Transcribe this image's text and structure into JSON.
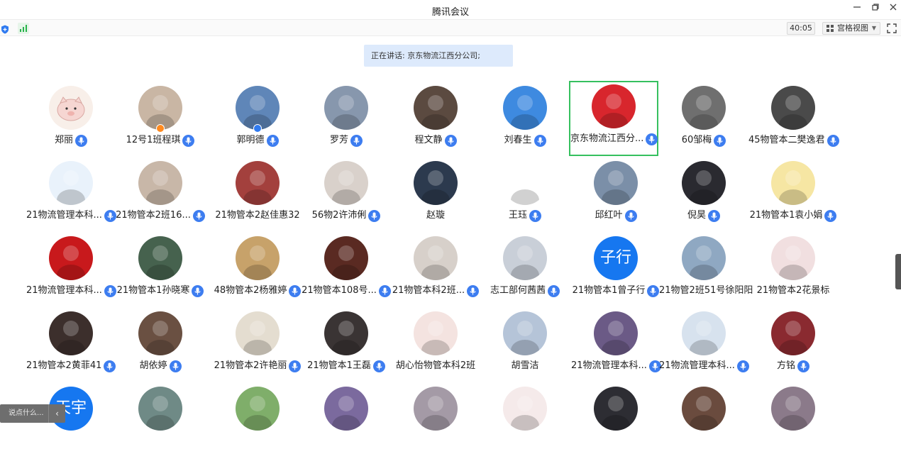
{
  "app": {
    "title": "腾讯会议"
  },
  "toolbar": {
    "timer": "40:05",
    "view_label": "宫格视图"
  },
  "speaking_banner": "正在讲话: 京东物流江西分公司;",
  "chat": {
    "placeholder": "说点什么..."
  },
  "participants": [
    {
      "name": "郑丽",
      "mic": true,
      "avatar": "pig",
      "color": "#f8efe9"
    },
    {
      "name": "12号1班程琪",
      "mic": true,
      "avatar": "photo",
      "color": "#c9b6a4",
      "badge": "host"
    },
    {
      "name": "郭明德",
      "mic": true,
      "avatar": "photo",
      "color": "#5f86b8",
      "badge": "cohost"
    },
    {
      "name": "罗芳",
      "mic": true,
      "avatar": "photo",
      "color": "#8797ad"
    },
    {
      "name": "程文静",
      "mic": true,
      "avatar": "photo",
      "color": "#5b4a40"
    },
    {
      "name": "刘春生",
      "mic": true,
      "avatar": "photo",
      "color": "#3e8ae0"
    },
    {
      "name": "京东物流江西分...",
      "mic": true,
      "avatar": "photo",
      "color": "#d8262d",
      "active": true
    },
    {
      "name": "60邹梅",
      "mic": true,
      "avatar": "photo",
      "color": "#6f6f6f"
    },
    {
      "name": "45物管本二樊逸君",
      "mic": true,
      "avatar": "photo",
      "color": "#4a4a4a"
    },
    {
      "name": "21物流管理本科...",
      "mic": true,
      "avatar": "photo",
      "color": "#e9f2fb"
    },
    {
      "name": "21物管本2班16...",
      "mic": true,
      "avatar": "photo",
      "color": "#c8b7a8"
    },
    {
      "name": "21物管本2赵佳惠32",
      "mic": false,
      "avatar": "photo",
      "color": "#a3403d"
    },
    {
      "name": "56物2许沛俐",
      "mic": true,
      "avatar": "photo",
      "color": "#d9d1cb"
    },
    {
      "name": "赵璇",
      "mic": false,
      "avatar": "photo",
      "color": "#2c3a4e"
    },
    {
      "name": "王珏",
      "mic": true,
      "avatar": "photo",
      "color": "#ffffff"
    },
    {
      "name": "邱红叶",
      "mic": true,
      "avatar": "photo",
      "color": "#7b8fa8"
    },
    {
      "name": "倪昊",
      "mic": true,
      "avatar": "photo",
      "color": "#2a2a30"
    },
    {
      "name": "21物管本1袁小娟",
      "mic": true,
      "avatar": "photo",
      "color": "#f6e6a3"
    },
    {
      "name": "21物流管理本科...",
      "mic": true,
      "avatar": "photo",
      "color": "#c8191c"
    },
    {
      "name": "21物管本1孙晓寒",
      "mic": true,
      "avatar": "photo",
      "color": "#46624e"
    },
    {
      "name": "48物管本2杨雅婷",
      "mic": true,
      "avatar": "photo",
      "color": "#c7a26a"
    },
    {
      "name": "21物管本108号...",
      "mic": true,
      "avatar": "photo",
      "color": "#5a2a22"
    },
    {
      "name": "21物管本科2班...",
      "mic": true,
      "avatar": "photo",
      "color": "#d7d0ca"
    },
    {
      "name": "志工部何茜茜",
      "mic": true,
      "avatar": "photo",
      "color": "#c9cfd8"
    },
    {
      "name": "21物管本1曾子行",
      "mic": true,
      "avatar": "text",
      "text": "子行",
      "color": "#1677f0"
    },
    {
      "name": "21物管2班51号徐阳阳",
      "mic": false,
      "avatar": "photo",
      "color": "#8fa8c2"
    },
    {
      "name": "21物管本2花景标",
      "mic": false,
      "avatar": "photo",
      "color": "#f1dfe0"
    },
    {
      "name": "21物管本2黄菲41",
      "mic": true,
      "avatar": "photo",
      "color": "#3c2f2c"
    },
    {
      "name": "胡依婷",
      "mic": true,
      "avatar": "photo",
      "color": "#6a5042"
    },
    {
      "name": "21物管本2许艳丽",
      "mic": true,
      "avatar": "photo",
      "color": "#e4ddd0"
    },
    {
      "name": "21物管本1王磊",
      "mic": true,
      "avatar": "photo",
      "color": "#3a3434"
    },
    {
      "name": "胡心怡物管本科2班",
      "mic": false,
      "avatar": "photo",
      "color": "#f4e3e0"
    },
    {
      "name": "胡雪洁",
      "mic": false,
      "avatar": "photo",
      "color": "#b5c4d8"
    },
    {
      "name": "21物流管理本科...",
      "mic": true,
      "avatar": "photo",
      "color": "#6b5a86"
    },
    {
      "name": "21物流管理本科...",
      "mic": true,
      "avatar": "photo",
      "color": "#d7e2ee"
    },
    {
      "name": "方铭",
      "mic": true,
      "avatar": "photo",
      "color": "#8a2a30"
    },
    {
      "name": "",
      "mic": false,
      "avatar": "text",
      "text": "天宇",
      "color": "#1677f0"
    },
    {
      "name": "",
      "mic": false,
      "avatar": "photo",
      "color": "#6f8a86"
    },
    {
      "name": "",
      "mic": false,
      "avatar": "photo",
      "color": "#7fae6a"
    },
    {
      "name": "",
      "mic": false,
      "avatar": "photo",
      "color": "#7b6a9e"
    },
    {
      "name": "",
      "mic": false,
      "avatar": "photo",
      "color": "#a49aa6"
    },
    {
      "name": "",
      "mic": false,
      "avatar": "photo",
      "color": "#f5eaea"
    },
    {
      "name": "",
      "mic": false,
      "avatar": "photo",
      "color": "#2d2d33"
    },
    {
      "name": "",
      "mic": false,
      "avatar": "photo",
      "color": "#6a4b3e"
    },
    {
      "name": "",
      "mic": false,
      "avatar": "photo",
      "color": "#8b7a8a"
    }
  ]
}
